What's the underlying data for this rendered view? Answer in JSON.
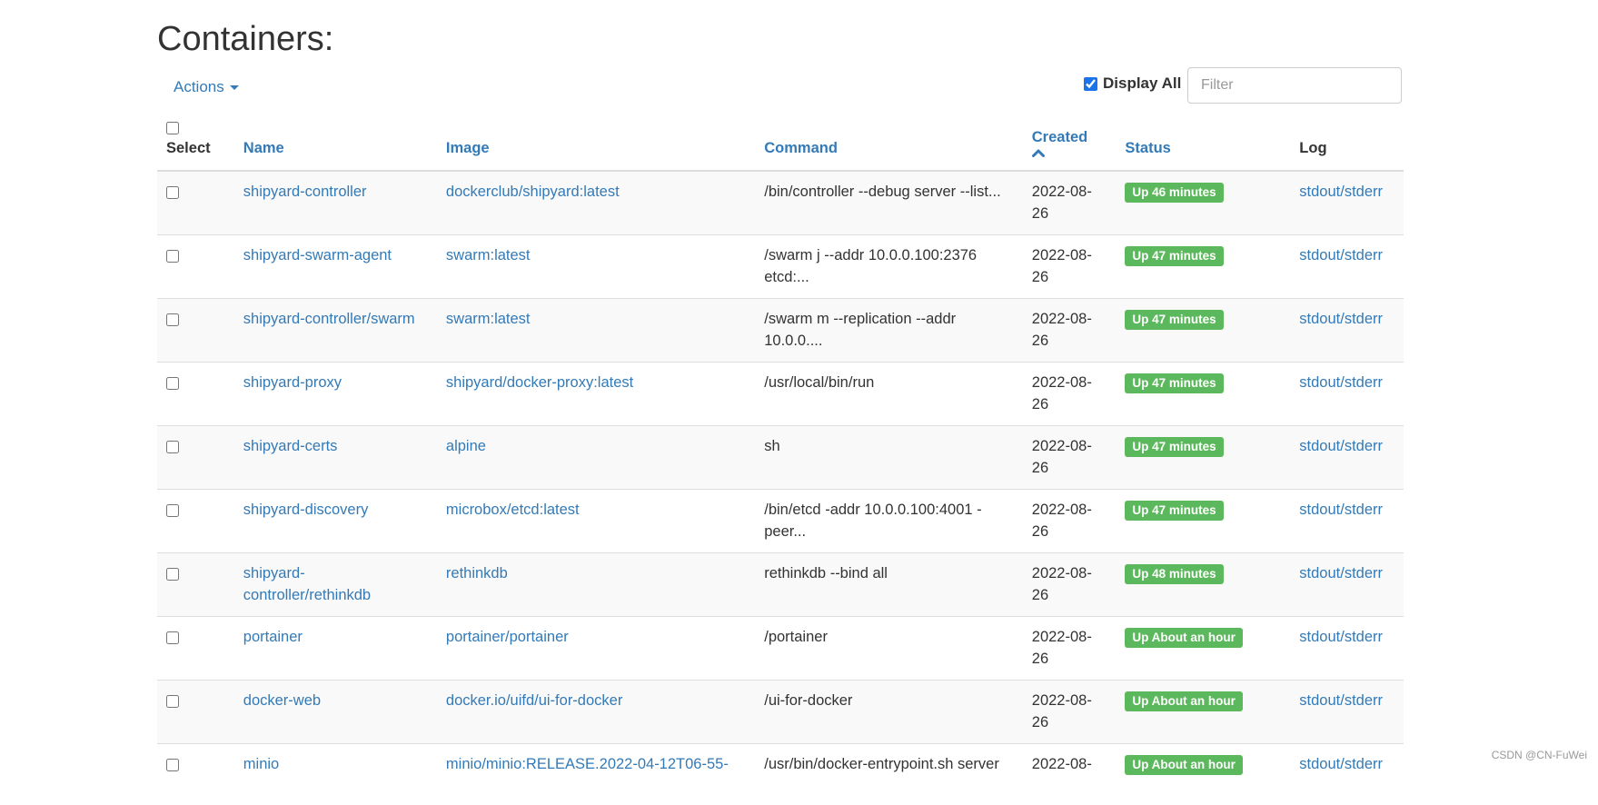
{
  "page": {
    "title": "Containers:",
    "actions_label": "Actions",
    "display_all_label": "Display All",
    "display_all_checked": true,
    "filter_placeholder": "Filter",
    "watermark": "CSDN @CN-FuWei"
  },
  "table": {
    "headers": {
      "select": "Select",
      "name": "Name",
      "image": "Image",
      "command": "Command",
      "created": "Created",
      "status": "Status",
      "log": "Log"
    },
    "rows": [
      {
        "name": "shipyard-controller",
        "image": "dockerclub/shipyard:latest",
        "command": "/bin/controller --debug server --list...",
        "created": "2022-08-26",
        "status": "Up 46 minutes",
        "log": "stdout/stderr"
      },
      {
        "name": "shipyard-swarm-agent",
        "image": "swarm:latest",
        "command": "/swarm j --addr 10.0.0.100:2376 etcd:...",
        "created": "2022-08-26",
        "status": "Up 47 minutes",
        "log": "stdout/stderr"
      },
      {
        "name": "shipyard-controller/swarm",
        "image": "swarm:latest",
        "command": "/swarm m --replication --addr 10.0.0....",
        "created": "2022-08-26",
        "status": "Up 47 minutes",
        "log": "stdout/stderr"
      },
      {
        "name": "shipyard-proxy",
        "image": "shipyard/docker-proxy:latest",
        "command": "/usr/local/bin/run",
        "created": "2022-08-26",
        "status": "Up 47 minutes",
        "log": "stdout/stderr"
      },
      {
        "name": "shipyard-certs",
        "image": "alpine",
        "command": "sh",
        "created": "2022-08-26",
        "status": "Up 47 minutes",
        "log": "stdout/stderr"
      },
      {
        "name": "shipyard-discovery",
        "image": "microbox/etcd:latest",
        "command": "/bin/etcd -addr 10.0.0.100:4001 -peer...",
        "created": "2022-08-26",
        "status": "Up 47 minutes",
        "log": "stdout/stderr"
      },
      {
        "name": "shipyard-controller/rethinkdb",
        "image": "rethinkdb",
        "command": "rethinkdb --bind all",
        "created": "2022-08-26",
        "status": "Up 48 minutes",
        "log": "stdout/stderr"
      },
      {
        "name": "portainer",
        "image": "portainer/portainer",
        "command": "/portainer",
        "created": "2022-08-26",
        "status": "Up About an hour",
        "log": "stdout/stderr"
      },
      {
        "name": "docker-web",
        "image": "docker.io/uifd/ui-for-docker",
        "command": "/ui-for-docker",
        "created": "2022-08-26",
        "status": "Up About an hour",
        "log": "stdout/stderr"
      },
      {
        "name": "minio",
        "image": "minio/minio:RELEASE.2022-04-12T06-55-",
        "command": "/usr/bin/docker-entrypoint.sh server",
        "created": "2022-08-",
        "status": "Up About an hour",
        "log": "stdout/stderr"
      }
    ]
  },
  "icons": {
    "caret": "caret-down-icon",
    "sort": "chevron-up-icon"
  },
  "colors": {
    "link": "#337ab7",
    "status_running": "#5cb85c"
  }
}
